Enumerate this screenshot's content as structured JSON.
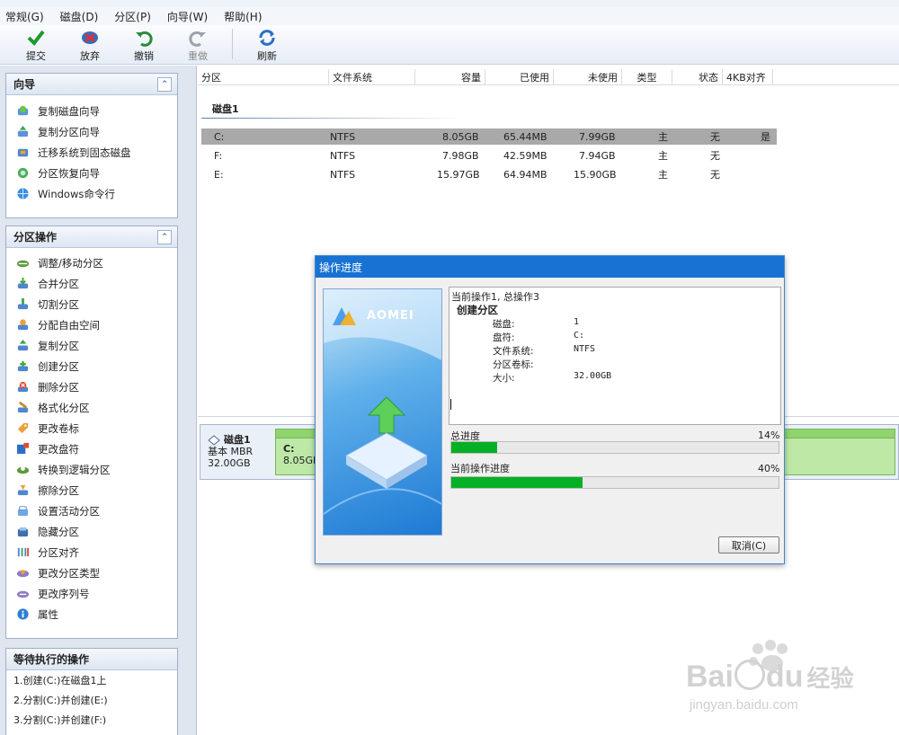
{
  "menu": [
    "常规(G)",
    "磁盘(D)",
    "分区(P)",
    "向导(W)",
    "帮助(H)"
  ],
  "toolbar": {
    "submit": "提交",
    "discard": "放弃",
    "undo": "撤销",
    "redo": "重做",
    "refresh": "刷新"
  },
  "wizard_panel": {
    "title": "向导",
    "items": [
      "复制磁盘向导",
      "复制分区向导",
      "迁移系统到固态磁盘",
      "分区恢复向导",
      "Windows命令行"
    ]
  },
  "ops_panel": {
    "title": "分区操作",
    "items": [
      "调整/移动分区",
      "合并分区",
      "切割分区",
      "分配自由空间",
      "复制分区",
      "创建分区",
      "删除分区",
      "格式化分区",
      "更改卷标",
      "更改盘符",
      "转换到逻辑分区",
      "擦除分区",
      "设置活动分区",
      "隐藏分区",
      "分区对齐",
      "更改分区类型",
      "更改序列号",
      "属性"
    ]
  },
  "pending_panel": {
    "title": "等待执行的操作",
    "items": [
      "1.创建(C:)在磁盘1上",
      "2.分割(C:)并创建(E:)",
      "3.分割(C:)并创建(F:)"
    ]
  },
  "columns": [
    "分区",
    "文件系统",
    "容量",
    "已使用",
    "未使用",
    "类型",
    "状态",
    "4KB对齐"
  ],
  "disk_name": "磁盘1",
  "partitions": [
    {
      "name": "C:",
      "fs": "NTFS",
      "capacity": "8.05GB",
      "used": "65.44MB",
      "free": "7.99GB",
      "type": "主",
      "status": "无",
      "align": "是"
    },
    {
      "name": "F:",
      "fs": "NTFS",
      "capacity": "7.98GB",
      "used": "42.59MB",
      "free": "7.94GB",
      "type": "主",
      "status": "无",
      "align": ""
    },
    {
      "name": "E:",
      "fs": "NTFS",
      "capacity": "15.97GB",
      "used": "64.94MB",
      "free": "15.90GB",
      "type": "主",
      "status": "无",
      "align": ""
    }
  ],
  "disk_card": {
    "name": "磁盘1",
    "type": "基本 MBR",
    "size": "32.00GB",
    "partition_label": "C:",
    "partition_size": "8.05GB"
  },
  "dialog": {
    "title": "操作进度",
    "brand": "AOMEI",
    "line1": "当前操作1, 总操作3",
    "line2": "创建分区",
    "details": [
      {
        "k": "磁盘:",
        "v": "1"
      },
      {
        "k": "盘符:",
        "v": "C:"
      },
      {
        "k": "文件系统:",
        "v": "NTFS"
      },
      {
        "k": "分区卷标:",
        "v": ""
      },
      {
        "k": "大小:",
        "v": "32.00GB"
      }
    ],
    "total_label": "总进度",
    "total_pct_text": "14%",
    "total_progress": 0.14,
    "current_label": "当前操作进度",
    "current_pct_text": "40%",
    "current_progress": 0.4,
    "cancel": "取消(C)"
  },
  "watermark": {
    "brand": "Bai",
    "brand2": "du",
    "brand3": "经验",
    "url": "jingyan.baidu.com"
  },
  "colors": {
    "progress": "#06b025",
    "dialog_title": "#1872d4",
    "selected_row": "#a9a9a9"
  }
}
